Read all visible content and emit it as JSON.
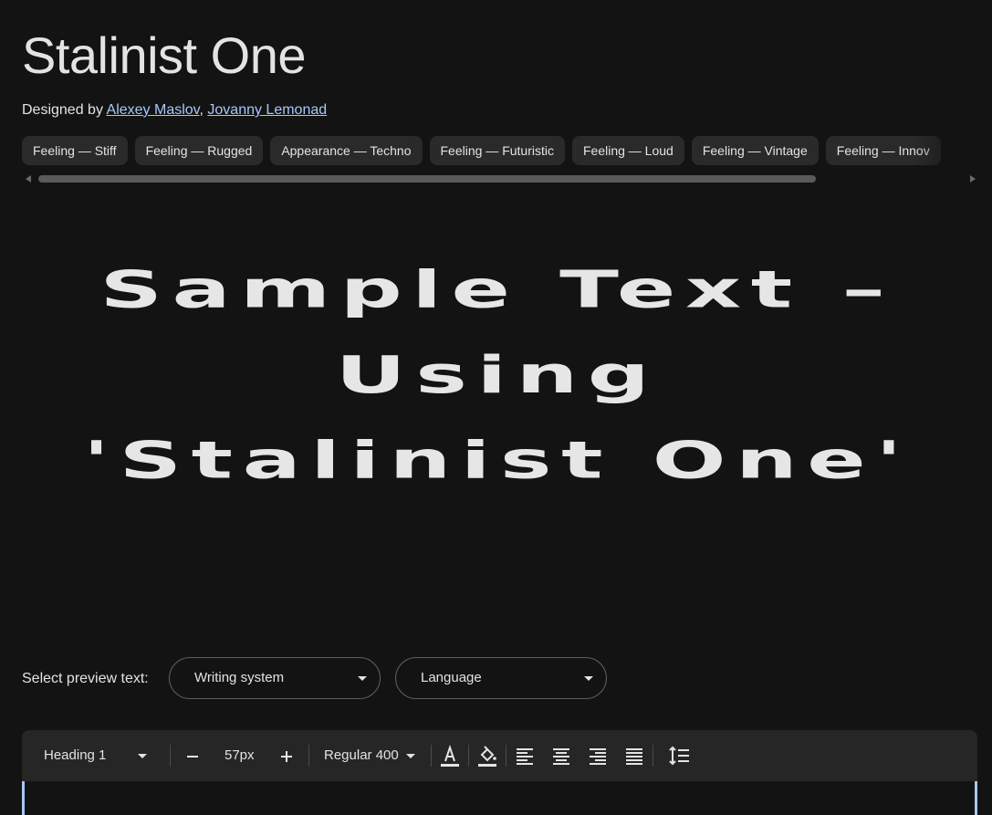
{
  "font": {
    "name": "Stalinist One",
    "designed_by_label": "Designed by",
    "designers": [
      "Alexey Maslov",
      "Jovanny Lemonad"
    ],
    "designer_separator": ","
  },
  "tags": [
    "Feeling — Stiff",
    "Feeling — Rugged",
    "Appearance — Techno",
    "Feeling — Futuristic",
    "Feeling — Loud",
    "Feeling — Vintage",
    "Feeling — Innov"
  ],
  "sample": {
    "lines": [
      "Sample Text –",
      "Using",
      "'Stalinist One'"
    ]
  },
  "preview": {
    "label": "Select preview text:",
    "writing_system": "Writing system",
    "language": "Language"
  },
  "toolbar": {
    "style": "Heading 1",
    "size": "57px",
    "weight": "Regular 400",
    "icons": [
      "text-color-icon",
      "highlight-color-icon",
      "align-left-icon",
      "align-center-icon",
      "align-right-icon",
      "align-justify-icon",
      "line-height-icon"
    ]
  },
  "colors": {
    "background": "#131313",
    "text": "#e3e3e3",
    "link": "#a8c7fa",
    "chip": "#2a2a2a",
    "toolbar": "#262626",
    "accent": "#a8c7fa"
  }
}
